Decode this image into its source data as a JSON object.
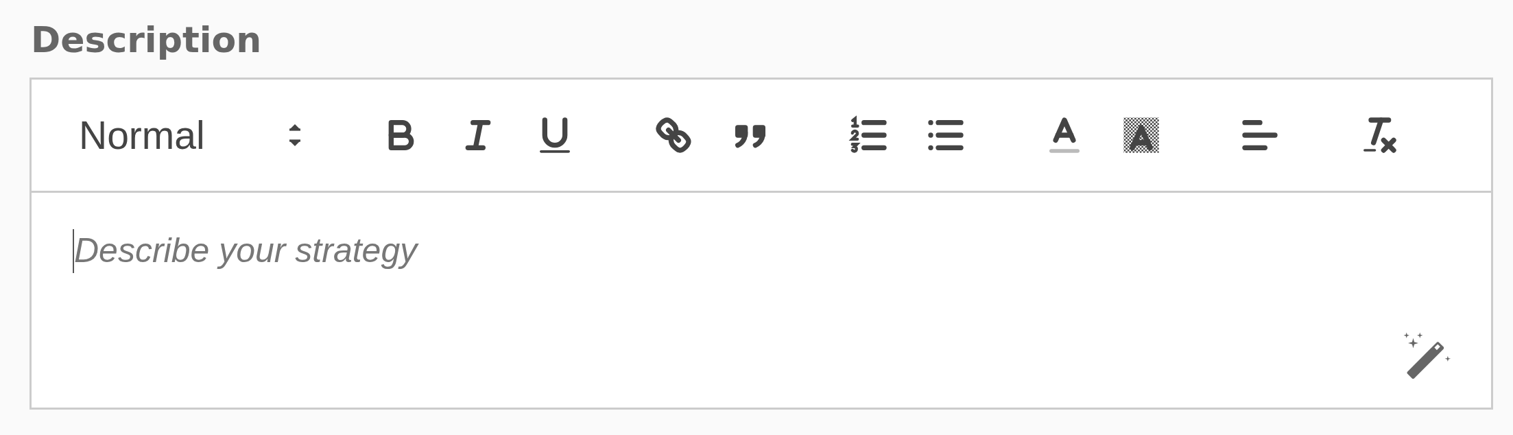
{
  "label": "Description",
  "editor": {
    "toolbar": {
      "header_select": {
        "value": "Normal"
      },
      "groups": [
        {
          "buttons": [
            {
              "kind": "bold"
            },
            {
              "kind": "italic"
            },
            {
              "kind": "underline"
            }
          ]
        },
        {
          "buttons": [
            {
              "kind": "link"
            },
            {
              "kind": "blockquote"
            }
          ]
        },
        {
          "buttons": [
            {
              "kind": "ordered-list"
            },
            {
              "kind": "bullet-list"
            }
          ]
        },
        {
          "buttons": [
            {
              "kind": "color"
            },
            {
              "kind": "background"
            }
          ]
        },
        {
          "buttons": [
            {
              "kind": "align"
            }
          ]
        },
        {
          "buttons": [
            {
              "kind": "clean"
            }
          ]
        }
      ]
    },
    "placeholder": "Describe your strategy"
  }
}
